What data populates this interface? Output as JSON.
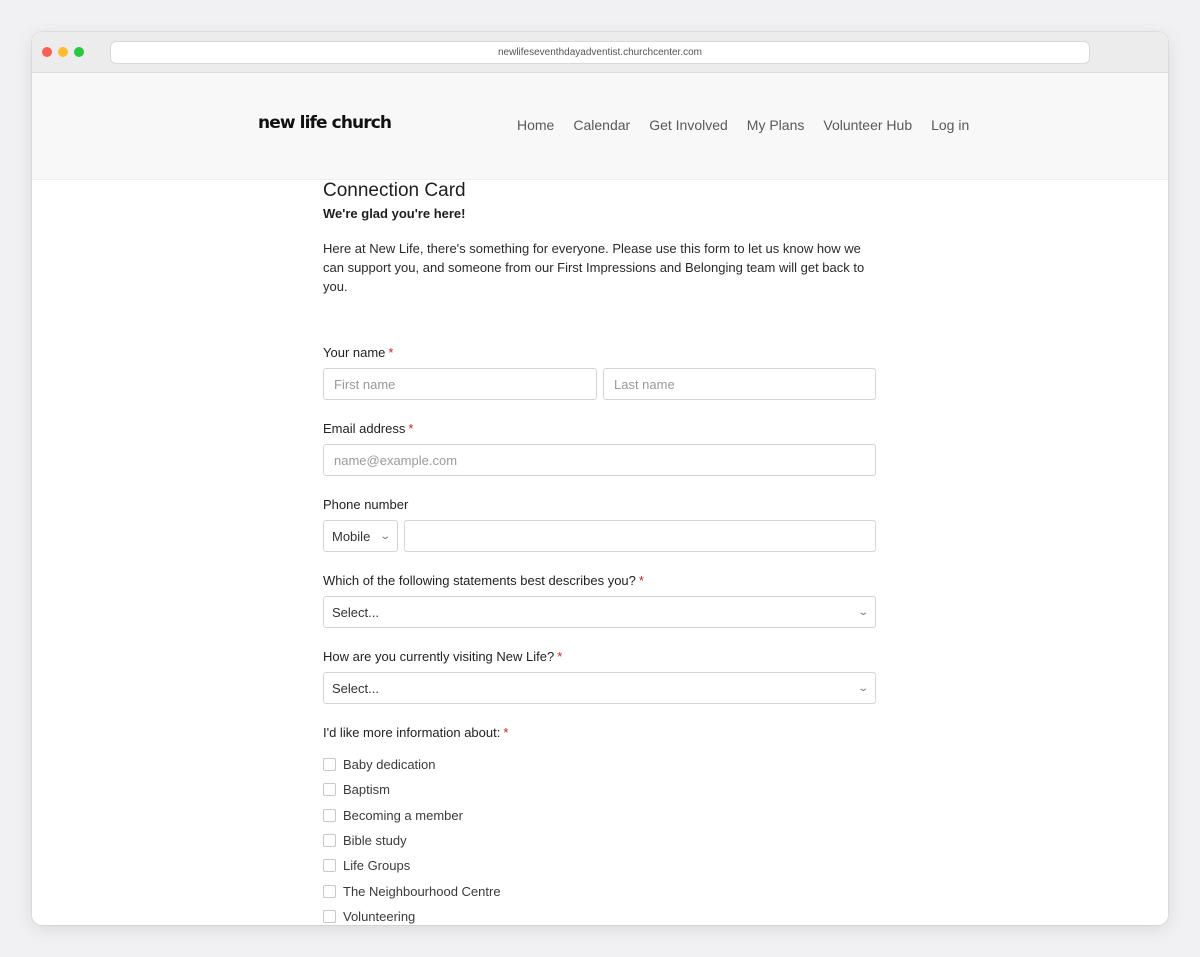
{
  "browser": {
    "url": "newlifeseventhdayadventist.churchcenter.com"
  },
  "header": {
    "logo": "new life church",
    "nav": [
      "Home",
      "Calendar",
      "Get Involved",
      "My Plans",
      "Volunteer Hub",
      "Log in"
    ]
  },
  "form": {
    "title": "Connection Card",
    "subtitle": "We're glad you're here!",
    "intro": "Here at New Life, there's something for everyone. Please use this form to let us know how we can support you, and someone from our First Impressions and Belonging team will get back to you.",
    "required_mark": "*",
    "name": {
      "label": "Your name",
      "first_placeholder": "First name",
      "last_placeholder": "Last name"
    },
    "email": {
      "label": "Email address",
      "placeholder": "name@example.com"
    },
    "phone": {
      "label": "Phone number",
      "type_value": "Mobile",
      "number_value": ""
    },
    "describes": {
      "label": "Which of the following statements best describes you?",
      "value": "Select..."
    },
    "visiting": {
      "label": "How are you currently visiting New Life?",
      "value": "Select..."
    },
    "info": {
      "label": "I'd like more information about:",
      "options": [
        "Baby dedication",
        "Baptism",
        "Becoming a member",
        "Bible study",
        "Life Groups",
        "The Neighbourhood Centre",
        "Volunteering"
      ]
    }
  },
  "colors": {
    "required": "#c2281e",
    "header_bg": "#f8f8f8",
    "page_bg": "#f1f1f3"
  }
}
